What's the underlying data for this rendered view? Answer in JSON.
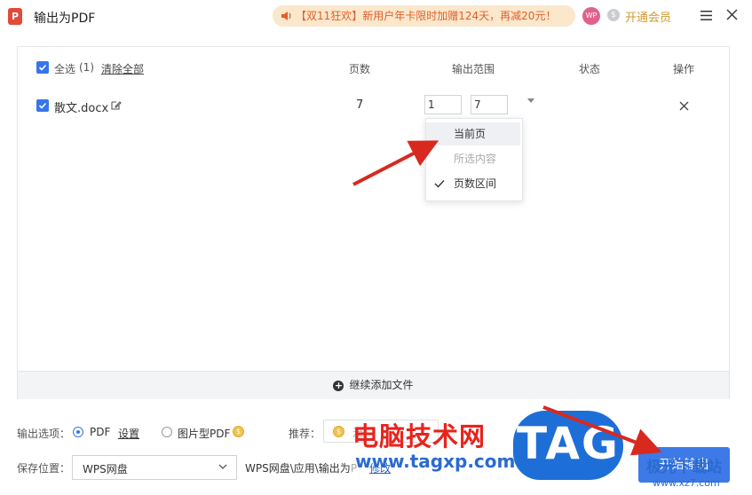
{
  "window": {
    "title": "输出为PDF",
    "app_logo": "P",
    "promo_text": "【双11狂欢】新用户年卡限时加赠124天，再减20元！",
    "avatar_text": "WP",
    "vip_label": "开通会员",
    "menu_icon": "hamburger-icon",
    "close_icon": "close-icon"
  },
  "file_list": {
    "select_all_label": "全选",
    "select_all_count": "(1)",
    "clear_all_label": "清除全部",
    "columns": {
      "pages": "页数",
      "output_range": "输出范围",
      "status": "状态",
      "actions": "操作"
    },
    "rows": [
      {
        "name": "散文.docx",
        "pages": "7",
        "range_from": "1",
        "range_to": "7",
        "status": ""
      }
    ],
    "add_more_label": "继续添加文件"
  },
  "range_dropdown": {
    "items": [
      {
        "label": "当前页",
        "state": "highlighted"
      },
      {
        "label": "所选内容",
        "state": "disabled"
      },
      {
        "label": "页数区间",
        "state": "checked"
      }
    ]
  },
  "output_options": {
    "label": "输出选项：",
    "pdf_label": "PDF",
    "settings_label": "设置",
    "image_pdf_label": "图片型PDF",
    "selected": "PDF",
    "recommend_label": "推荐：",
    "recommend_text": "流"
  },
  "save_location": {
    "label": "保存位置：",
    "selected": "WPS网盘",
    "path_text": "WPS网盘\\应用\\输出为",
    "path_partial": "P",
    "path_link": "修改"
  },
  "start_button_label": "开始输出",
  "watermark": {
    "cn_text": "电脑技术网",
    "url": "www.tagxp.com",
    "logo": "TAG",
    "corner_text": "极光下载站",
    "corner_url": "www.xz7.com"
  },
  "colors": {
    "accent": "#3d7ae8",
    "promo_bg": "#fbe7cc",
    "promo_text": "#e0602a",
    "arrow": "#d8291f"
  }
}
